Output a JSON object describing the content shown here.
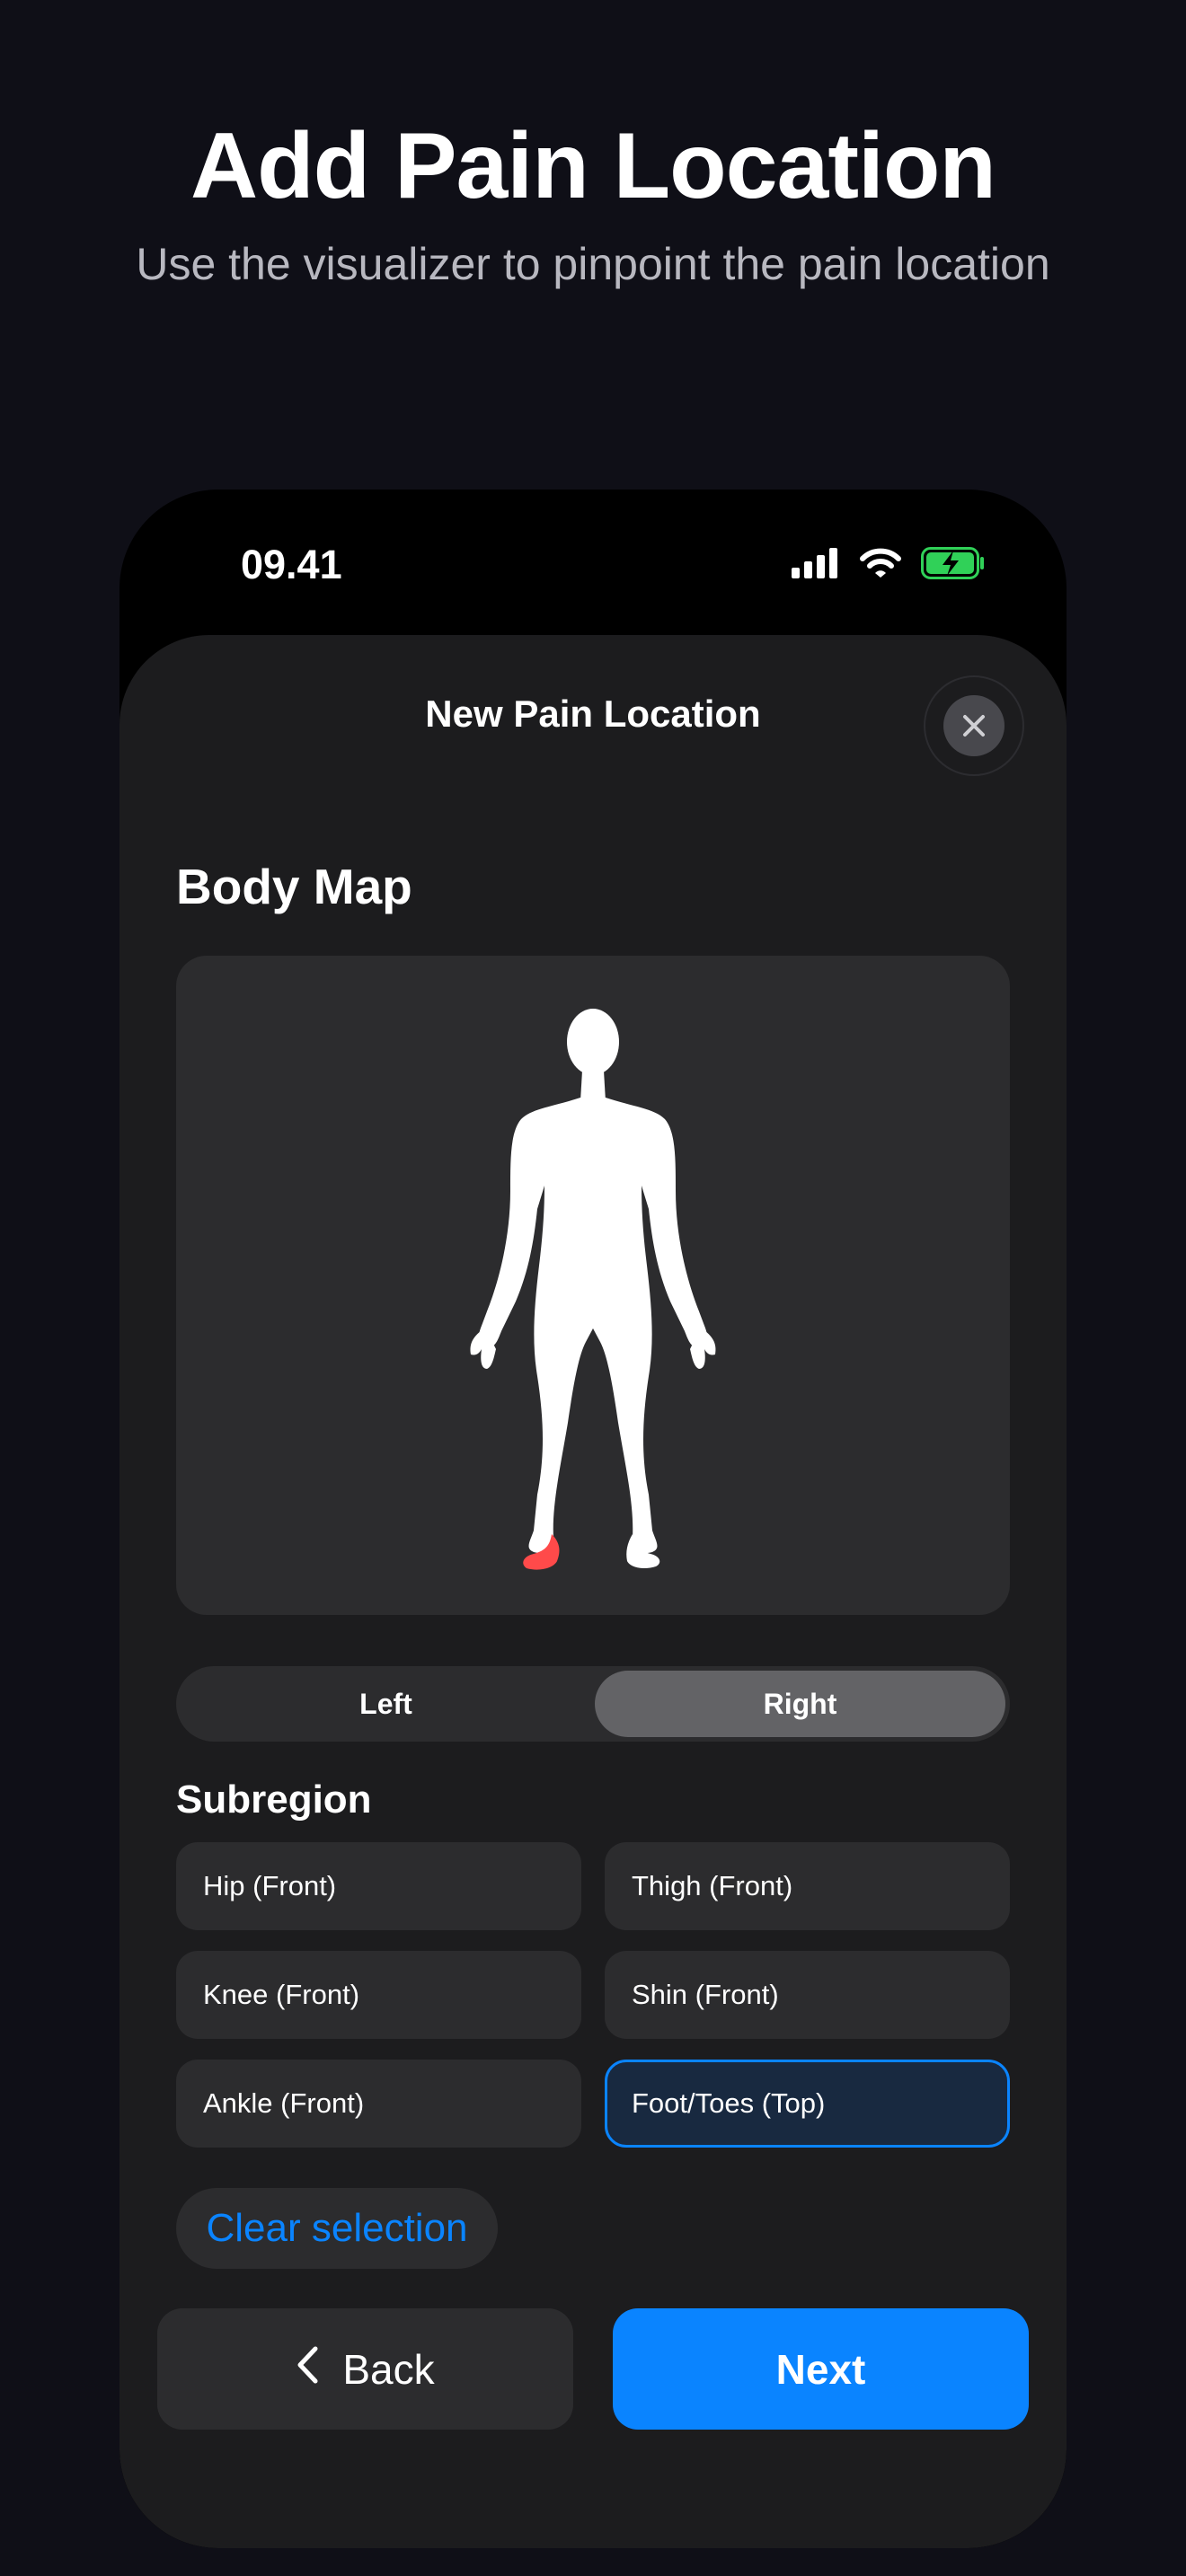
{
  "hero": {
    "title": "Add Pain Location",
    "subtitle": "Use the visualizer to pinpoint the pain location"
  },
  "status_bar": {
    "time": "09.41",
    "icons": [
      "cellular-signal-icon",
      "wifi-icon",
      "battery-charging-icon"
    ]
  },
  "sheet": {
    "title": "New Pain Location",
    "close_icon": "close-icon"
  },
  "body_map": {
    "title": "Body Map",
    "highlighted_region": "right-foot",
    "highlight_color": "#ff4a4a"
  },
  "side_toggle": {
    "options": [
      "Left",
      "Right"
    ],
    "selected": "Right"
  },
  "subregion": {
    "title": "Subregion",
    "options": [
      {
        "label": "Hip (Front)",
        "selected": false
      },
      {
        "label": "Thigh (Front)",
        "selected": false
      },
      {
        "label": "Knee (Front)",
        "selected": false
      },
      {
        "label": "Shin (Front)",
        "selected": false
      },
      {
        "label": "Ankle (Front)",
        "selected": false
      },
      {
        "label": "Foot/Toes (Top)",
        "selected": true
      }
    ]
  },
  "actions": {
    "clear_label": "Clear selection",
    "back_label": "Back",
    "next_label": "Next"
  },
  "colors": {
    "background": "#0f0f17",
    "sheet": "#1c1c1e",
    "accent": "#0a84ff",
    "selected_chip_bg": "#182940"
  }
}
